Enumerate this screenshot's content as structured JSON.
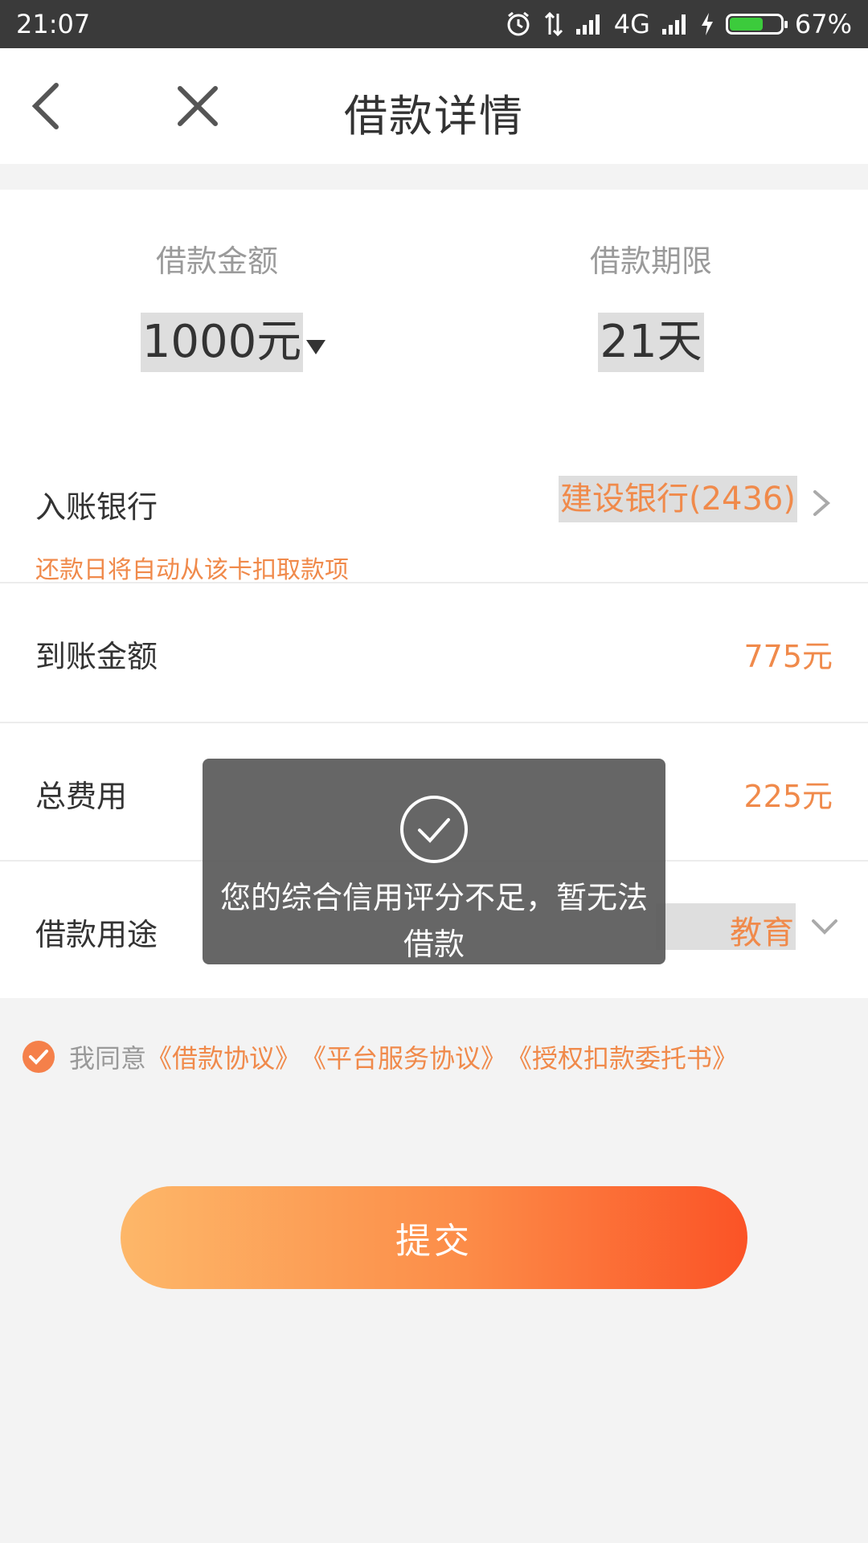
{
  "status_bar": {
    "time": "21:07",
    "network": "4G",
    "battery_percent": "67%",
    "battery_level": 0.67,
    "icons": [
      "alarm-icon",
      "data-transfer-icon",
      "signal-icon",
      "charging-icon",
      "battery-icon"
    ]
  },
  "nav": {
    "title": "借款详情",
    "back_icon": "chevron-left-icon",
    "close_icon": "close-icon"
  },
  "loan": {
    "amount_label": "借款金额",
    "amount_value": "1000元",
    "term_label": "借款期限",
    "term_value": "21天"
  },
  "rows": {
    "bank_label": "入账银行",
    "bank_value": "建设银行(2436)",
    "bank_note": "还款日将自动从该卡扣取款项",
    "arrive_label": "到账金额",
    "arrive_value": "775元",
    "fee_label": "总费用",
    "fee_value": "225元",
    "use_label": "借款用途",
    "use_value": "教育"
  },
  "agreement": {
    "prefix": "我同意",
    "links": [
      "《借款协议》",
      "《平台服务协议》",
      "《授权扣款委托书》"
    ],
    "checked": true
  },
  "submit_label": "提交",
  "toast": {
    "message": "您的综合信用评分不足，暂无法借款",
    "icon": "check-circle-icon"
  },
  "colors": {
    "accent": "#f08a4b",
    "status_bar": "#3a3a3a",
    "button_gradient_start": "#fdb769",
    "button_gradient_end": "#fb5326"
  }
}
